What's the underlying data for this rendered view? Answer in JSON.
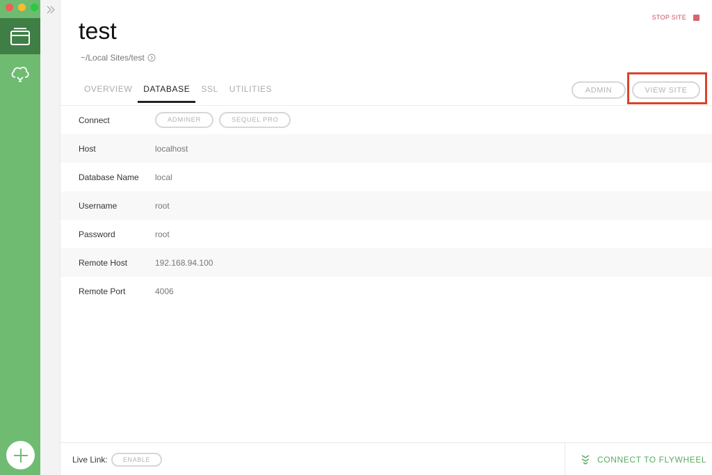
{
  "site": {
    "title": "test",
    "path": "~/Local Sites/test",
    "stop_label": "STOP SITE"
  },
  "tabs": [
    {
      "label": "OVERVIEW",
      "active": false
    },
    {
      "label": "DATABASE",
      "active": true
    },
    {
      "label": "SSL",
      "active": false
    },
    {
      "label": "UTILITIES",
      "active": false
    }
  ],
  "actions": {
    "admin_label": "ADMIN",
    "view_site_label": "VIEW SITE"
  },
  "database": {
    "connect": {
      "label": "Connect",
      "buttons": [
        "ADMINER",
        "SEQUEL PRO"
      ]
    },
    "host": {
      "label": "Host",
      "value": "localhost"
    },
    "db_name": {
      "label": "Database Name",
      "value": "local"
    },
    "username": {
      "label": "Username",
      "value": "root"
    },
    "password": {
      "label": "Password",
      "value": "root"
    },
    "remote_host": {
      "label": "Remote Host",
      "value": "192.168.94.100"
    },
    "remote_port": {
      "label": "Remote Port",
      "value": "4006"
    }
  },
  "footer": {
    "live_link_label": "Live Link:",
    "enable_label": "ENABLE",
    "flywheel_label": "CONNECT TO FLYWHEEL"
  },
  "colors": {
    "sidebar": "#6fbb72",
    "sidebar_active": "#3f7f46",
    "stop": "#cf4e5a",
    "flywheel": "#5aa95f",
    "highlight": "#d9432a"
  },
  "icons": {
    "sites": "sites-icon",
    "cloud": "cloud-icon",
    "add": "plus-icon",
    "collapse": "double-chevron-right-icon",
    "path_arrow": "circle-arrow-right-icon",
    "flywheel": "flywheel-icon"
  }
}
